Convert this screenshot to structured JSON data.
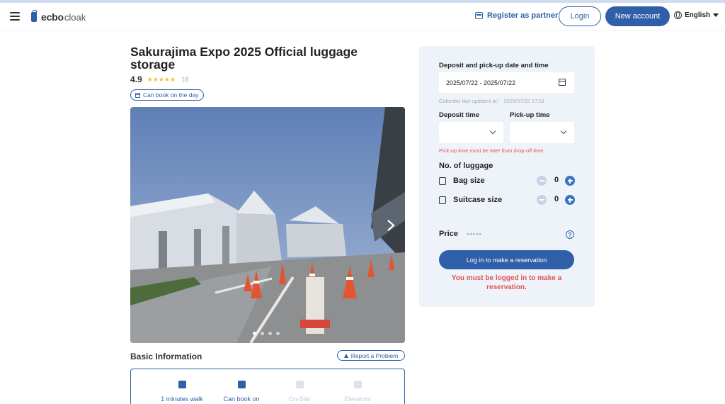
{
  "header": {
    "logo_main": "ecbo",
    "logo_sub": "cloak",
    "register_label": "Register as partner",
    "login_label": "Login",
    "new_account_label": "New account",
    "language": "English"
  },
  "listing": {
    "title": "Sakurajima Expo 2025 Official luggage storage",
    "rating": "4.9",
    "stars": 5,
    "review_count": "18",
    "badge": "Can book on the day",
    "photo_count": 4,
    "active_photo": 1
  },
  "basic_info": {
    "title": "Basic Information",
    "report_label": "Report a Problem",
    "features": [
      {
        "label": "1 minutes walk",
        "icon": "train-icon",
        "enabled": true
      },
      {
        "label": "Can book on",
        "icon": "calendar-icon",
        "enabled": true
      },
      {
        "label": "On-Site",
        "icon": "onsite-icon",
        "enabled": false
      },
      {
        "label": "Elevators",
        "icon": "elevator-icon",
        "enabled": false
      }
    ]
  },
  "booking": {
    "date_label": "Deposit and pick-up date and time",
    "date_value": "2025/07/22 - 2025/07/22",
    "calendar_updated": "Calendar last updated at： 2025/07/22 17:51",
    "deposit_time_label": "Deposit time",
    "pickup_time_label": "Pick-up time",
    "time_warning": "Pick-up time must be later than drop-off time.",
    "luggage_title": "No. of luggage",
    "bag_label": "Bag size",
    "bag_count": "0",
    "suitcase_label": "Suitcase size",
    "suitcase_count": "0",
    "price_label": "Price",
    "price_value": "-----",
    "help_glyph": "?",
    "reserve_label": "Log in to make a reservation",
    "login_warning": "You must be logged in to make a reservation."
  },
  "colors": {
    "brand": "#2f5fa8",
    "warning": "#e05353",
    "panel_bg": "#eef3fa",
    "star": "#f2c230"
  }
}
